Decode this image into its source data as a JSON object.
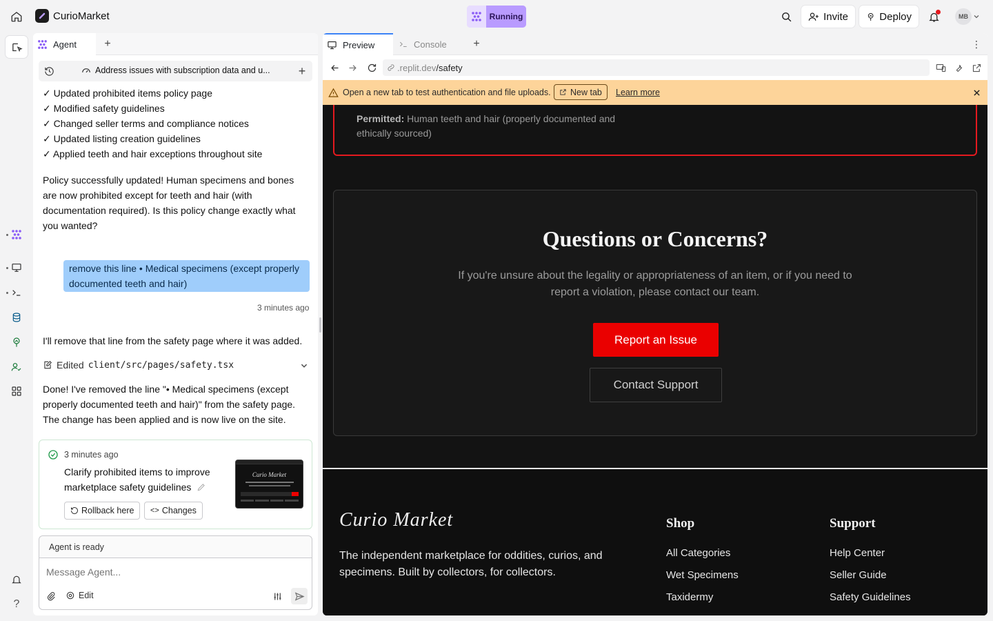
{
  "topbar": {
    "app_name": "CurioMarket",
    "status": "Running",
    "invite_label": "Invite",
    "deploy_label": "Deploy",
    "avatar_initials": "MB"
  },
  "left_panel": {
    "tab_label": "Agent",
    "chat_title": "Address issues with subscription data and u...",
    "checklist": [
      "✓ Updated prohibited items policy page",
      "✓ Modified safety guidelines",
      "✓ Changed seller terms and compliance notices",
      "✓ Updated listing creation guidelines",
      "✓ Applied teeth and hair exceptions throughout site"
    ],
    "agent_msg_1": "Policy successfully updated! Human specimens and bones are now prohibited except for teeth and hair (with documentation required). Is this policy change exactly what you wanted?",
    "user_msg": "remove this line • Medical specimens (except properly documented teeth and hair)",
    "user_msg_time": "3 minutes ago",
    "agent_msg_2": "I'll remove that line from the safety page where it was added.",
    "edited_prefix": "Edited",
    "edited_file": "client/src/pages/safety.tsx",
    "agent_msg_3": "Done! I've removed the line \"• Medical specimens (except properly documented teeth and hair)\" from the safety page. The change has been applied and is now live on the site.",
    "checkpoint": {
      "time": "3 minutes ago",
      "title": "Clarify prohibited items to improve marketplace safety guidelines",
      "rollback_label": "Rollback here",
      "changes_label": "Changes"
    },
    "composer": {
      "status": "Agent is ready",
      "placeholder": "Message Agent...",
      "edit_label": "Edit"
    }
  },
  "right_panel": {
    "tabs": [
      "Preview",
      "Console"
    ],
    "url_host": ".replit.dev",
    "url_path": "/safety",
    "banner": {
      "text": "Open a new tab to test authentication and file uploads.",
      "new_tab_label": "New tab",
      "learn_more": "Learn more"
    },
    "site": {
      "permitted_label": "Permitted:",
      "permitted_text": "Human teeth and hair (properly documented and ethically sourced)",
      "questions_title": "Questions or Concerns?",
      "questions_body": "If you're unsure about the legality or appropriateness of an item, or if you need to report a violation, please contact our team.",
      "report_btn": "Report an Issue",
      "contact_btn": "Contact Support",
      "footer": {
        "logo_text": "Curio Market",
        "tagline": "The independent marketplace for oddities, curios, and specimens. Built by collectors, for collectors.",
        "shop_heading": "Shop",
        "shop_links": [
          "All Categories",
          "Wet Specimens",
          "Taxidermy"
        ],
        "support_heading": "Support",
        "support_links": [
          "Help Center",
          "Seller Guide",
          "Safety Guidelines"
        ]
      }
    }
  },
  "colors": {
    "accent": "#b99bff",
    "user_bubble": "#9fcdfb",
    "banner": "#fdd49a",
    "report_red": "#ea0000",
    "site_bg": "#131313"
  }
}
